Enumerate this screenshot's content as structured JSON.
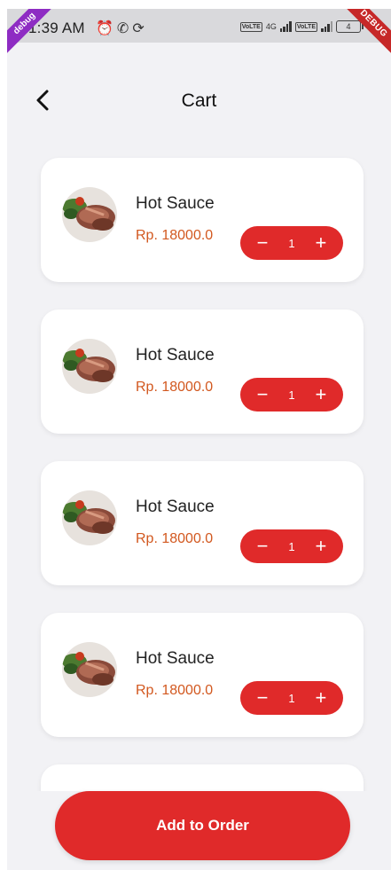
{
  "status_bar": {
    "time": "1:39 AM",
    "icons_left": [
      "alarm-icon",
      "whatsapp-icon",
      "sync-icon"
    ],
    "network_label": "4G",
    "battery_level": "4",
    "debug_left": "debug",
    "debug_right": "DEBUG"
  },
  "header": {
    "title": "Cart",
    "back_icon": "back-arrow-icon"
  },
  "cart_items": [
    {
      "name": "Hot Sauce",
      "price": "Rp. 18000.0",
      "quantity": "1",
      "minus": "−",
      "plus": "+"
    },
    {
      "name": "Hot Sauce",
      "price": "Rp. 18000.0",
      "quantity": "1",
      "minus": "−",
      "plus": "+"
    },
    {
      "name": "Hot Sauce",
      "price": "Rp. 18000.0",
      "quantity": "1",
      "minus": "−",
      "plus": "+"
    },
    {
      "name": "Hot Sauce",
      "price": "Rp. 18000.0",
      "quantity": "1",
      "minus": "−",
      "plus": "+"
    }
  ],
  "footer": {
    "add_to_order_label": "Add to Order"
  },
  "colors": {
    "accent": "#e02a2a",
    "price": "#d2581f",
    "background": "#f2f2f5"
  }
}
